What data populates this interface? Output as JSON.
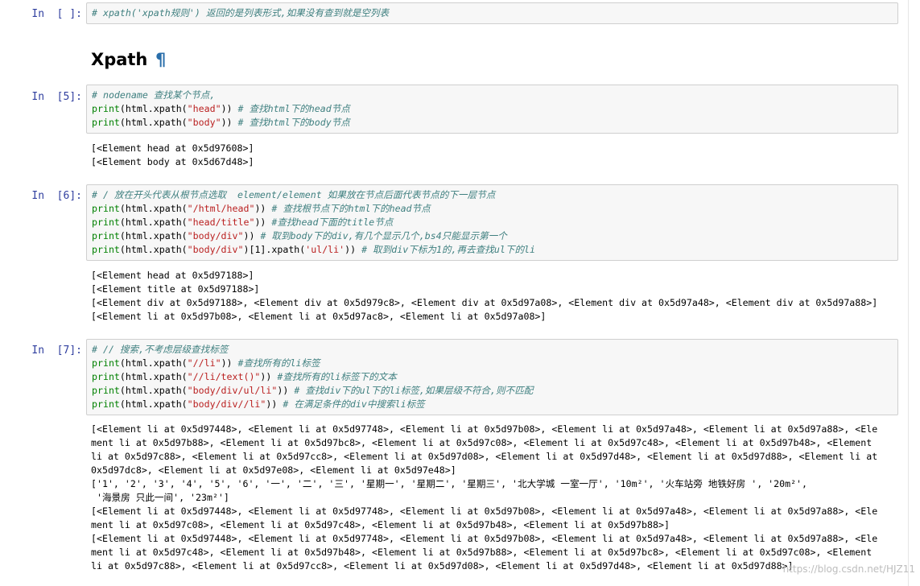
{
  "cell0": {
    "prompt": "In  [ ]:",
    "lines": [
      "# xpath('xpath规则') 返回的是列表形式,如果没有查到就是空列表"
    ]
  },
  "heading": {
    "title": "Xpath",
    "anchor": "¶"
  },
  "cell5": {
    "prompt": "In  [5]:",
    "lines": [
      "# nodename 查找某个节点,",
      "print(html.xpath(\"head\")) # 查找html下的head节点",
      "print(html.xpath(\"body\")) # 查找html下的body节点"
    ],
    "output": [
      "[<Element head at 0x5d97608>]",
      "[<Element body at 0x5d67d48>]"
    ]
  },
  "cell6": {
    "prompt": "In  [6]:",
    "lines": [
      "# / 放在开头代表从根节点选取  element/element 如果放在节点后面代表节点的下一层节点",
      "print(html.xpath(\"/html/head\")) # 查找根节点下的html下的head节点",
      "print(html.xpath(\"head/title\")) #查找head下面的title节点",
      "print(html.xpath(\"body/div\")) # 取到body下的div,有几个显示几个,bs4只能显示第一个",
      "print(html.xpath(\"body/div\")[1].xpath('ul/li')) # 取到div下标为1的,再去查找ul下的li"
    ],
    "output": [
      "[<Element head at 0x5d97188>]",
      "[<Element title at 0x5d97188>]",
      "[<Element div at 0x5d97188>, <Element div at 0x5d979c8>, <Element div at 0x5d97a08>, <Element div at 0x5d97a48>, <Element div at 0x5d97a88>]",
      "[<Element li at 0x5d97b08>, <Element li at 0x5d97ac8>, <Element li at 0x5d97a08>]"
    ]
  },
  "cell7": {
    "prompt": "In  [7]:",
    "lines": [
      "# // 搜索,不考虑层级查找标签",
      "print(html.xpath(\"//li\")) #查找所有的li标签",
      "print(html.xpath(\"//li/text()\")) #查找所有的li标签下的文本",
      "print(html.xpath(\"body/div/ul/li\")) # 查找div下的ul下的li标签,如果层级不符合,则不匹配",
      "print(html.xpath(\"body/div//li\")) # 在满足条件的div中搜索li标签"
    ],
    "output": [
      "[<Element li at 0x5d97448>, <Element li at 0x5d97748>, <Element li at 0x5d97b08>, <Element li at 0x5d97a48>, <Element li at 0x5d97a88>, <Ele",
      "ment li at 0x5d97b88>, <Element li at 0x5d97bc8>, <Element li at 0x5d97c08>, <Element li at 0x5d97c48>, <Element li at 0x5d97b48>, <Element",
      "li at 0x5d97c88>, <Element li at 0x5d97cc8>, <Element li at 0x5d97d08>, <Element li at 0x5d97d48>, <Element li at 0x5d97d88>, <Element li at",
      "0x5d97dc8>, <Element li at 0x5d97e08>, <Element li at 0x5d97e48>]",
      "['1', '2', '3', '4', '5', '6', '一', '二', '三', '星期一', '星期二', '星期三', '北大学城 一室一厅', '10m²', '火车站旁 地铁好房 ', '20m²',",
      " '海景房 只此一间', '23m²']",
      "[<Element li at 0x5d97448>, <Element li at 0x5d97748>, <Element li at 0x5d97b08>, <Element li at 0x5d97a48>, <Element li at 0x5d97a88>, <Ele",
      "ment li at 0x5d97c08>, <Element li at 0x5d97c48>, <Element li at 0x5d97b48>, <Element li at 0x5d97b88>]",
      "[<Element li at 0x5d97448>, <Element li at 0x5d97748>, <Element li at 0x5d97b08>, <Element li at 0x5d97a48>, <Element li at 0x5d97a88>, <Ele",
      "ment li at 0x5d97c48>, <Element li at 0x5d97b48>, <Element li at 0x5d97b88>, <Element li at 0x5d97bc8>, <Element li at 0x5d97c08>, <Element",
      "li at 0x5d97c88>, <Element li at 0x5d97cc8>, <Element li at 0x5d97d08>, <Element li at 0x5d97d48>, <Element li at 0x5d97d88>]"
    ]
  },
  "watermark": "https://blog.csdn.net/HJZ11"
}
